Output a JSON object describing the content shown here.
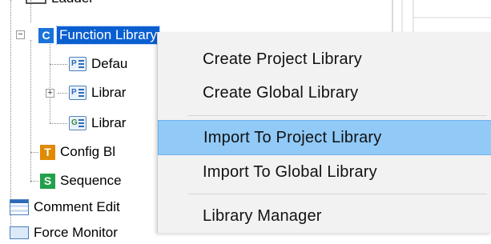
{
  "tree": {
    "items": [
      {
        "label": "Ladder",
        "icon": "ladder-icon"
      },
      {
        "label": "Function Library",
        "icon": "c-icon",
        "selected": true
      },
      {
        "label": "Defau",
        "icon": "p-icon"
      },
      {
        "label": "Librar",
        "icon": "p-icon"
      },
      {
        "label": "Librar",
        "icon": "g-icon"
      },
      {
        "label": "Config Bl",
        "icon": "t-icon"
      },
      {
        "label": "Sequence",
        "icon": "s-icon"
      },
      {
        "label": "Comment Edit",
        "icon": "comment-icon"
      },
      {
        "label": "Force Monitor",
        "icon": "monitor-icon"
      }
    ],
    "icon_letters": {
      "c": "C",
      "p": "P",
      "g": "G",
      "t": "T",
      "s": "S"
    },
    "colors": {
      "c": "#1a73d9",
      "t": "#e08a00",
      "s": "#22a04b",
      "selection": "#0a5fd0"
    }
  },
  "context_menu": {
    "items": [
      {
        "label": "Create Project Library"
      },
      {
        "label": "Create Global Library"
      },
      {
        "label": "Import To Project Library",
        "highlighted": true
      },
      {
        "label": "Import To Global Library"
      },
      {
        "label": "Library Manager"
      }
    ],
    "highlight_color": "#91c9f7"
  }
}
